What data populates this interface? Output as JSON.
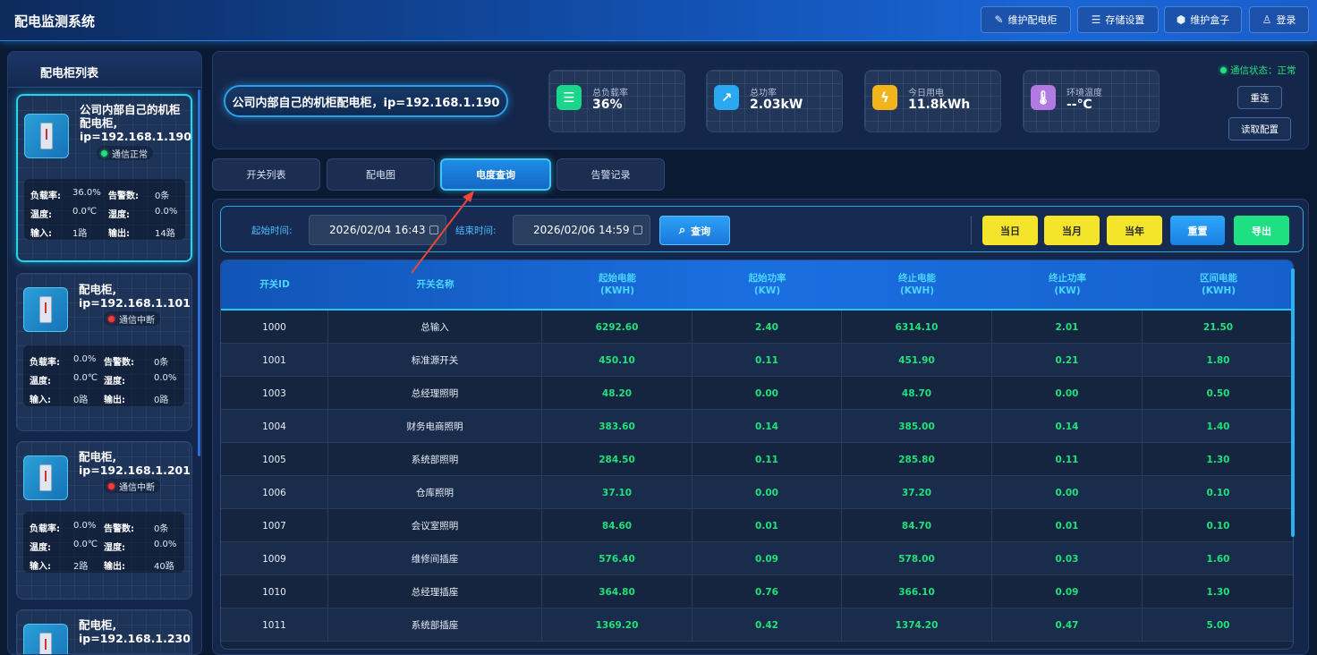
{
  "app": {
    "title": "配电监测系统"
  },
  "header_buttons": [
    {
      "label": "维护配电柜",
      "icon": "pencil-icon"
    },
    {
      "label": "存储设置",
      "icon": "list-icon"
    },
    {
      "label": "维护盒子",
      "icon": "box-icon"
    },
    {
      "label": "登录",
      "icon": "user-icon"
    }
  ],
  "sidebar": {
    "title": "配电柜列表",
    "cabinets": [
      {
        "name_line1": "公司内部自己的机柜",
        "name_line2": "配电柜,",
        "name_line3": "ip=192.168.1.190",
        "status": "通信正常",
        "status_ok": true,
        "load_label": "负载率:",
        "load": "36.0%",
        "alarm_label": "告警数:",
        "alarm": "0条",
        "temp_label": "温度:",
        "temp": "0.0℃",
        "hum_label": "湿度:",
        "hum": "0.0%",
        "in_label": "输入:",
        "in": "1路",
        "out_label": "输出:",
        "out": "14路"
      },
      {
        "name_line1": "配电柜,",
        "name_line2": "ip=192.168.1.101",
        "status": "通信中断",
        "status_ok": false,
        "load_label": "负载率:",
        "load": "0.0%",
        "alarm_label": "告警数:",
        "alarm": "0条",
        "temp_label": "温度:",
        "temp": "0.0℃",
        "hum_label": "湿度:",
        "hum": "0.0%",
        "in_label": "输入:",
        "in": "0路",
        "out_label": "输出:",
        "out": "0路"
      },
      {
        "name_line1": "配电柜,",
        "name_line2": "ip=192.168.1.201",
        "status": "通信中断",
        "status_ok": false,
        "load_label": "负载率:",
        "load": "0.0%",
        "alarm_label": "告警数:",
        "alarm": "0条",
        "temp_label": "温度:",
        "temp": "0.0℃",
        "hum_label": "湿度:",
        "hum": "0.0%",
        "in_label": "输入:",
        "in": "2路",
        "out_label": "输出:",
        "out": "40路"
      },
      {
        "name_line1": "配电柜,",
        "name_line2": "ip=192.168.1.230"
      }
    ]
  },
  "current_cabinet": {
    "title": "公司内部自己的机柜配电柜，ip=192.168.1.190"
  },
  "stat_cards": [
    {
      "label": "总负载率",
      "value": "36%",
      "icon": "storage-icon",
      "color": "#19d68c"
    },
    {
      "label": "总功率",
      "value": "2.03kW",
      "icon": "line-chart-icon",
      "color": "#2aa8f0"
    },
    {
      "label": "今日用电",
      "value": "11.8kWh",
      "icon": "lightning-icon",
      "color": "#f2b41c"
    },
    {
      "label": "环境温度",
      "value": "--℃",
      "icon": "thermometer-icon",
      "color": "#b07ae0"
    }
  ],
  "comm_status": "通信状态：正常",
  "reconnect_label": "重连",
  "read_config_label": "读取配置",
  "tabs": [
    "开关列表",
    "配电图",
    "电度查询",
    "告警记录"
  ],
  "active_tab": "电度查询",
  "query": {
    "start_label": "起始时间:",
    "start_value": "2026/02/04 16:43",
    "end_label": "结束时间:",
    "end_value": "2026/02/06 14:59",
    "search_label": "查询",
    "day_label": "当日",
    "month_label": "当月",
    "year_label": "当年",
    "reset_label": "重置",
    "export_label": "导出"
  },
  "table": {
    "headers": [
      {
        "l1": "开关ID",
        "l2": ""
      },
      {
        "l1": "开关名称",
        "l2": ""
      },
      {
        "l1": "起始电能",
        "l2": "(KWH)"
      },
      {
        "l1": "起始功率",
        "l2": "(KW)"
      },
      {
        "l1": "终止电能",
        "l2": "(KWH)"
      },
      {
        "l1": "终止功率",
        "l2": "(KW)"
      },
      {
        "l1": "区间电能",
        "l2": "(KWH)"
      }
    ],
    "rows": [
      [
        "1000",
        "总输入",
        "6292.60",
        "2.40",
        "6314.10",
        "2.01",
        "21.50"
      ],
      [
        "1001",
        "标准源开关",
        "450.10",
        "0.11",
        "451.90",
        "0.21",
        "1.80"
      ],
      [
        "1003",
        "总经理照明",
        "48.20",
        "0.00",
        "48.70",
        "0.00",
        "0.50"
      ],
      [
        "1004",
        "财务电商照明",
        "383.60",
        "0.14",
        "385.00",
        "0.14",
        "1.40"
      ],
      [
        "1005",
        "系统部照明",
        "284.50",
        "0.11",
        "285.80",
        "0.11",
        "1.30"
      ],
      [
        "1006",
        "仓库照明",
        "37.10",
        "0.00",
        "37.20",
        "0.00",
        "0.10"
      ],
      [
        "1007",
        "会议室照明",
        "84.60",
        "0.01",
        "84.70",
        "0.01",
        "0.10"
      ],
      [
        "1009",
        "维修间插座",
        "576.40",
        "0.09",
        "578.00",
        "0.03",
        "1.60"
      ],
      [
        "1010",
        "总经理插座",
        "364.80",
        "0.76",
        "366.10",
        "0.09",
        "1.30"
      ],
      [
        "1011",
        "系统部插座",
        "1369.20",
        "0.42",
        "1374.20",
        "0.47",
        "5.00"
      ]
    ]
  }
}
